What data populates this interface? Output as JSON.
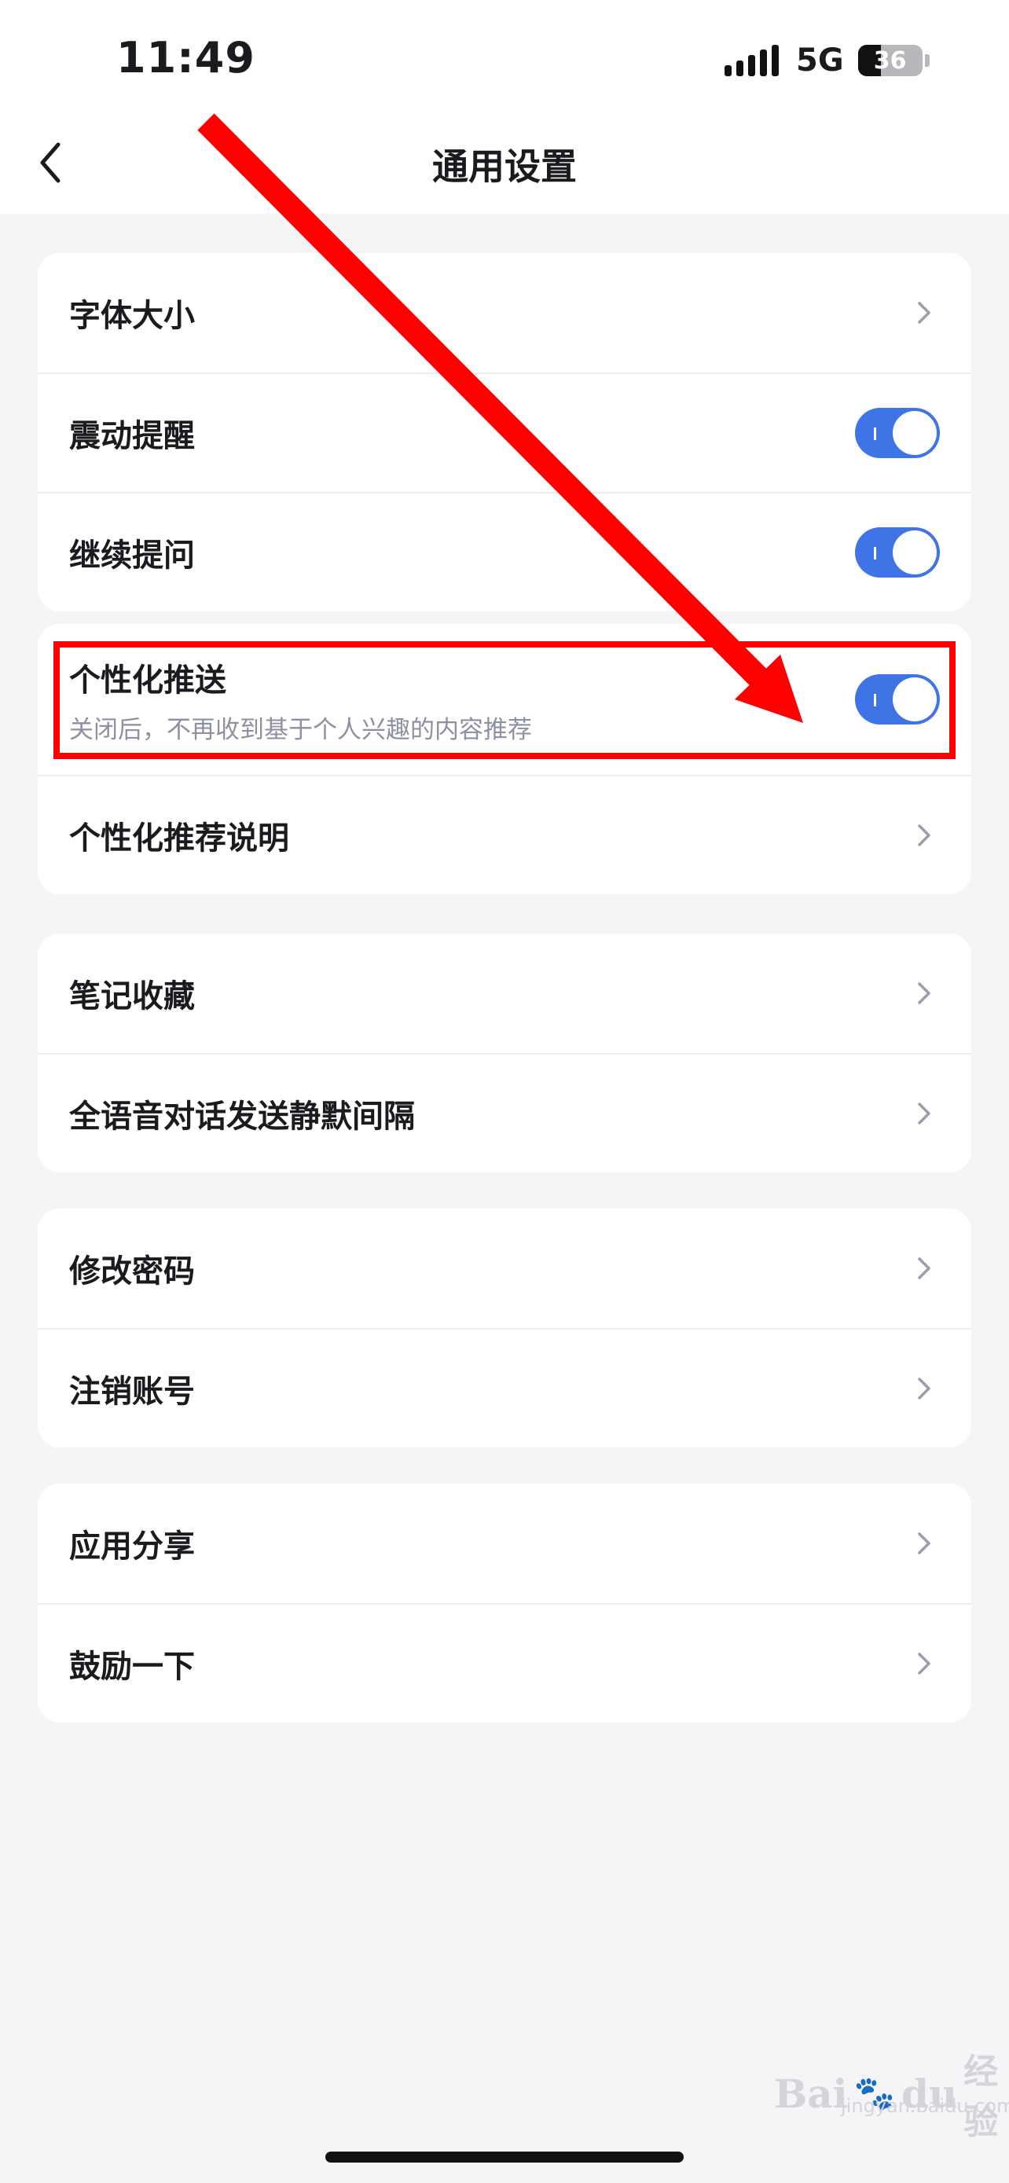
{
  "status_bar": {
    "time": "11:49",
    "network": "5G",
    "battery_label": "36",
    "battery_level": 0.36
  },
  "nav": {
    "title": "通用设置",
    "back_icon": "chevron-left-icon"
  },
  "groups": [
    {
      "rows": [
        {
          "label": "字体大小",
          "control": "chevron"
        },
        {
          "label": "震动提醒",
          "control": "toggle",
          "on": true
        },
        {
          "label": "继续提问",
          "control": "toggle",
          "on": true
        }
      ]
    },
    {
      "rows": [
        {
          "label": "个性化推送",
          "subtitle": "关闭后，不再收到基于个人兴趣的内容推荐",
          "control": "toggle",
          "on": true
        },
        {
          "label": "个性化推荐说明",
          "control": "chevron"
        }
      ]
    },
    {
      "rows": [
        {
          "label": "笔记收藏",
          "control": "chevron"
        },
        {
          "label": "全语音对话发送静默间隔",
          "control": "chevron"
        }
      ]
    },
    {
      "rows": [
        {
          "label": "修改密码",
          "control": "chevron"
        },
        {
          "label": "注销账号",
          "control": "chevron"
        }
      ]
    },
    {
      "rows": [
        {
          "label": "应用分享",
          "control": "chevron"
        },
        {
          "label": "鼓励一下",
          "control": "chevron"
        }
      ]
    }
  ],
  "watermark": {
    "brand": "Bai",
    "brand_tail": "du",
    "cn": "经验",
    "url": "jingyan.baidu.com"
  },
  "colors": {
    "accent": "#3f74e6",
    "annotation": "#ff0000",
    "background": "#f5f5f7"
  }
}
